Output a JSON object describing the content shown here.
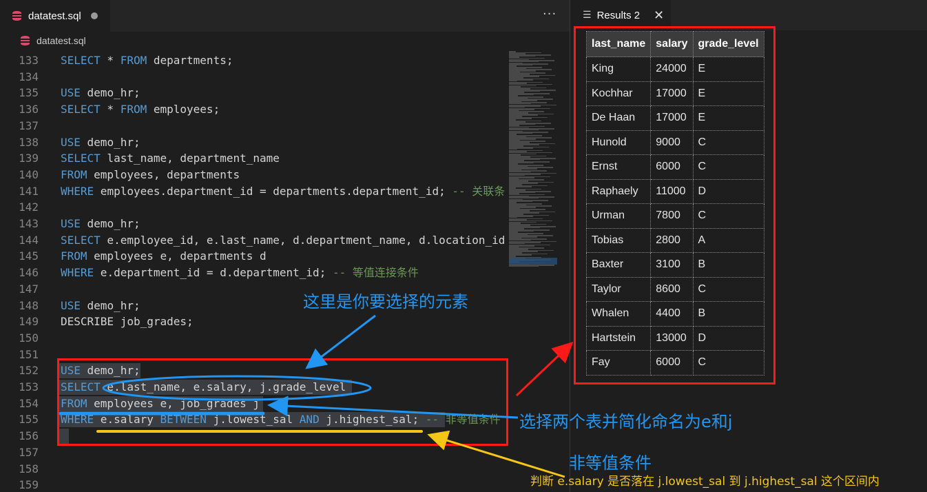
{
  "editor": {
    "tab_title": "datatest.sql",
    "breadcrumb": "datatest.sql",
    "more_icon": "···",
    "lines": [
      {
        "n": "133",
        "seg": [
          [
            "kw",
            "SELECT"
          ],
          [
            "t",
            " * "
          ],
          [
            "kw",
            "FROM"
          ],
          [
            "t",
            " departments;"
          ]
        ]
      },
      {
        "n": "134",
        "seg": []
      },
      {
        "n": "135",
        "seg": [
          [
            "kw",
            "USE"
          ],
          [
            "t",
            " demo_hr;"
          ]
        ]
      },
      {
        "n": "136",
        "seg": [
          [
            "kw",
            "SELECT"
          ],
          [
            "t",
            " * "
          ],
          [
            "kw",
            "FROM"
          ],
          [
            "t",
            " employees;"
          ]
        ]
      },
      {
        "n": "137",
        "seg": []
      },
      {
        "n": "138",
        "seg": [
          [
            "kw",
            "USE"
          ],
          [
            "t",
            " demo_hr;"
          ]
        ]
      },
      {
        "n": "139",
        "seg": [
          [
            "kw",
            "SELECT"
          ],
          [
            "t",
            " last_name, department_name"
          ]
        ]
      },
      {
        "n": "140",
        "seg": [
          [
            "kw",
            "FROM"
          ],
          [
            "t",
            " employees, departments"
          ]
        ]
      },
      {
        "n": "141",
        "seg": [
          [
            "kw",
            "WHERE"
          ],
          [
            "t",
            " employees.department_id = departments.department_id; "
          ],
          [
            "cm",
            "-- 关联条"
          ]
        ]
      },
      {
        "n": "142",
        "seg": []
      },
      {
        "n": "143",
        "seg": [
          [
            "kw",
            "USE"
          ],
          [
            "t",
            " demo_hr;"
          ]
        ]
      },
      {
        "n": "144",
        "seg": [
          [
            "kw",
            "SELECT"
          ],
          [
            "t",
            " e.employee_id, e.last_name, d.department_name, d.location_id"
          ]
        ]
      },
      {
        "n": "145",
        "seg": [
          [
            "kw",
            "FROM"
          ],
          [
            "t",
            " employees e, departments d"
          ]
        ]
      },
      {
        "n": "146",
        "seg": [
          [
            "kw",
            "WHERE"
          ],
          [
            "t",
            " e.department_id = d.department_id; "
          ],
          [
            "cm",
            "-- 等值连接条件"
          ]
        ]
      },
      {
        "n": "147",
        "seg": []
      },
      {
        "n": "148",
        "seg": [
          [
            "kw",
            "USE"
          ],
          [
            "t",
            " demo_hr;"
          ]
        ]
      },
      {
        "n": "149",
        "seg": [
          [
            "t",
            "DESCRIBE job_grades;"
          ]
        ]
      },
      {
        "n": "150",
        "seg": []
      },
      {
        "n": "151",
        "seg": []
      },
      {
        "n": "152",
        "seg": [
          [
            "kw",
            "USE"
          ],
          [
            "t",
            " demo_hr;"
          ]
        ]
      },
      {
        "n": "153",
        "seg": [
          [
            "kw",
            "SELECT"
          ],
          [
            "t",
            " e.last_name, e.salary, j.grade_level"
          ]
        ]
      },
      {
        "n": "154",
        "seg": [
          [
            "kw",
            "FROM"
          ],
          [
            "t",
            " employees e, job_grades j"
          ]
        ]
      },
      {
        "n": "155",
        "seg": [
          [
            "kw",
            "WHERE"
          ],
          [
            "t",
            " e.salary "
          ],
          [
            "kw",
            "BETWEEN"
          ],
          [
            "t",
            " j.lowest_sal "
          ],
          [
            "kw",
            "AND"
          ],
          [
            "t",
            " j.highest_sal; "
          ],
          [
            "cm",
            "-- 非等值条件"
          ]
        ]
      },
      {
        "n": "156",
        "seg": []
      },
      {
        "n": "157",
        "seg": []
      },
      {
        "n": "158",
        "seg": []
      },
      {
        "n": "159",
        "seg": []
      }
    ]
  },
  "results": {
    "tab_title": "Results 2",
    "close_icon": "✕",
    "columns": [
      "last_name",
      "salary",
      "grade_level"
    ],
    "rows": [
      [
        "King",
        "24000",
        "E"
      ],
      [
        "Kochhar",
        "17000",
        "E"
      ],
      [
        "De Haan",
        "17000",
        "E"
      ],
      [
        "Hunold",
        "9000",
        "C"
      ],
      [
        "Ernst",
        "6000",
        "C"
      ],
      [
        "Raphaely",
        "11000",
        "D"
      ],
      [
        "Urman",
        "7800",
        "C"
      ],
      [
        "Tobias",
        "2800",
        "A"
      ],
      [
        "Baxter",
        "3100",
        "B"
      ],
      [
        "Taylor",
        "8600",
        "C"
      ],
      [
        "Whalen",
        "4400",
        "B"
      ],
      [
        "Hartstein",
        "13000",
        "D"
      ],
      [
        "Fay",
        "6000",
        "C"
      ]
    ]
  },
  "annotations": {
    "select_elements": "这里是你要选择的元素",
    "choose_tables": "选择两个表并简化命名为e和j",
    "non_equi": "非等值条件",
    "judge": "判断 e.salary 是否落在 j.lowest_sal 到 j.highest_sal 这个区间内"
  },
  "colors": {
    "keyword": "#569cd6",
    "comment": "#6a9955",
    "annotation_blue": "#2196f3",
    "annotation_yellow": "#f5c518",
    "annotation_red": "#ff1a1a"
  }
}
